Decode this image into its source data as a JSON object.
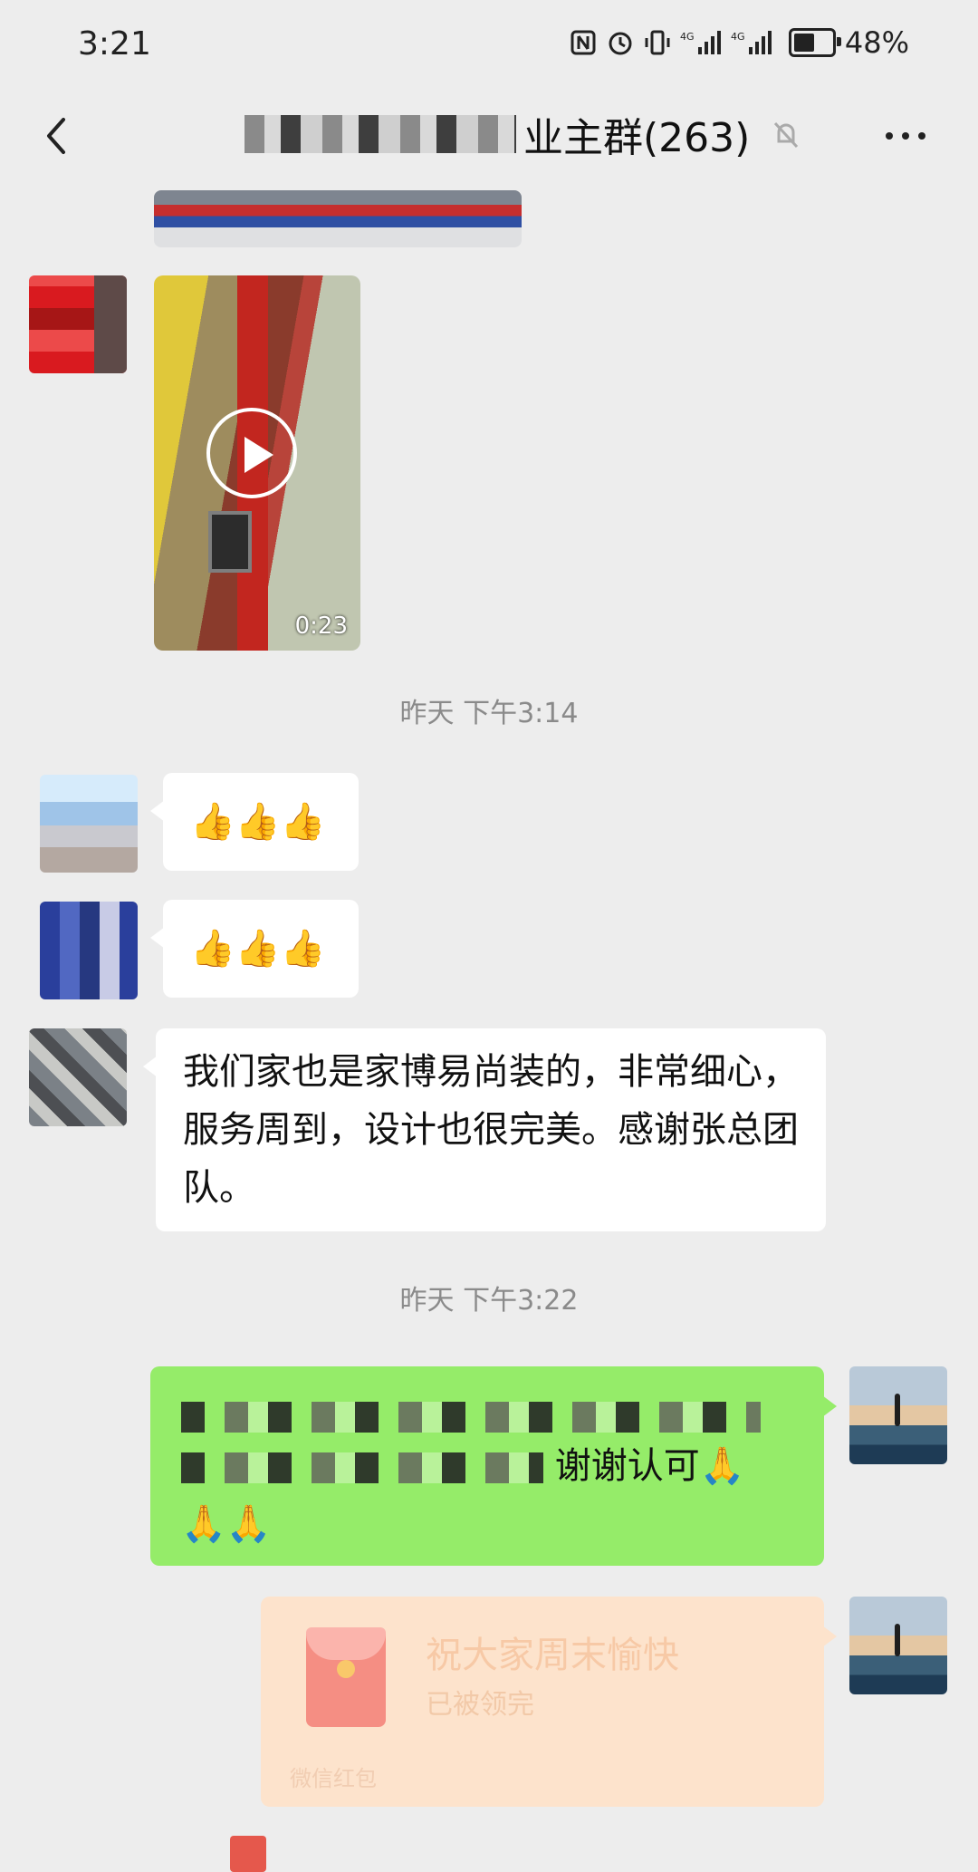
{
  "status": {
    "time": "3:21",
    "icons": [
      "nfc-icon",
      "alarm-icon",
      "vibrate-icon",
      "signal-icon",
      "signal-icon",
      "battery-icon"
    ],
    "battery_percent": "48%",
    "battery_level": 0.48
  },
  "header": {
    "title_visible": "业主群(263)",
    "title_redacted": true
  },
  "messages": {
    "video_duration": "0:23",
    "timestamp_1": "昨天 下午3:14",
    "thumbs_1": "👍👍👍",
    "thumbs_2": "👍👍👍",
    "text_1": "我们家也是家博易尚装的，非常细心，服务周到，设计也很完美。感谢张总团队。",
    "timestamp_2": "昨天 下午3:22",
    "my_text_suffix": "谢谢认可🙏",
    "my_text_line3": "🙏🙏",
    "redpacket_title": "祝大家周末愉快",
    "redpacket_status": "已被领完",
    "redpacket_footer": "微信红包"
  },
  "colors": {
    "background": "#ededed",
    "bubble_in": "#ffffff",
    "bubble_out": "#95ec69",
    "redpacket": "#fde3cc"
  }
}
